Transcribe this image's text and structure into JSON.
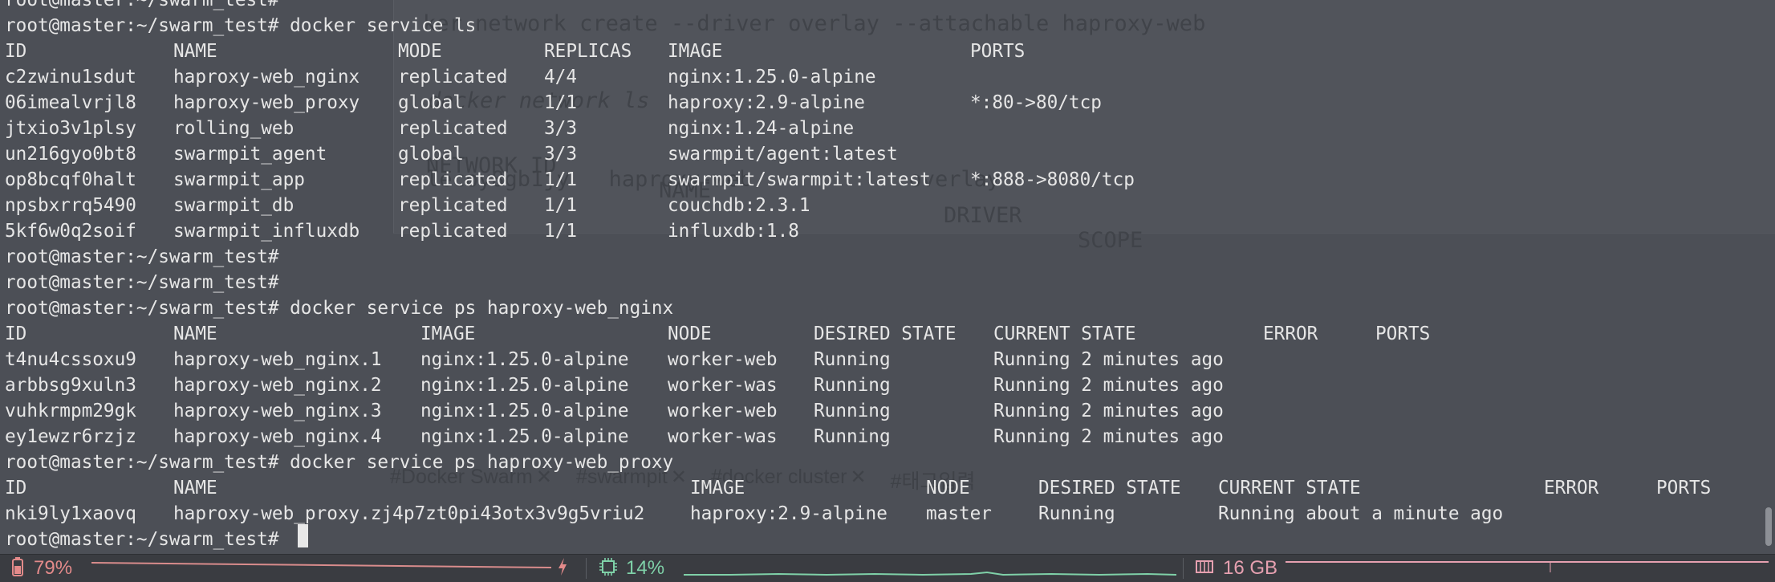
{
  "terminal": {
    "lines": [
      {
        "cols": [
          "root@master:~/swarm_test#"
        ]
      },
      {
        "cols": [
          "root@master:~/swarm_test# docker service ls"
        ]
      },
      {
        "cols": [
          "ID",
          "NAME",
          "MODE",
          "REPLICAS",
          "IMAGE",
          "PORTS"
        ]
      },
      {
        "cols": [
          "c2zwinu1sdut",
          "haproxy-web_nginx",
          "replicated",
          "4/4",
          "nginx:1.25.0-alpine",
          ""
        ]
      },
      {
        "cols": [
          "06imealvrjl8",
          "haproxy-web_proxy",
          "global",
          "1/1",
          "haproxy:2.9-alpine",
          "*:80->80/tcp"
        ]
      },
      {
        "cols": [
          "jtxio3v1plsy",
          "rolling_web",
          "replicated",
          "3/3",
          "nginx:1.24-alpine",
          ""
        ]
      },
      {
        "cols": [
          "un216gyo0bt8",
          "swarmpit_agent",
          "global",
          "3/3",
          "swarmpit/agent:latest",
          ""
        ]
      },
      {
        "cols": [
          "op8bcqf0halt",
          "swarmpit_app",
          "replicated",
          "1/1",
          "swarmpit/swarmpit:latest",
          "*:888->8080/tcp"
        ]
      },
      {
        "cols": [
          "npsbxrrq5490",
          "swarmpit_db",
          "replicated",
          "1/1",
          "couchdb:2.3.1",
          ""
        ]
      },
      {
        "cols": [
          "5kf6w0q2soif",
          "swarmpit_influxdb",
          "replicated",
          "1/1",
          "influxdb:1.8",
          ""
        ]
      },
      {
        "cols": [
          "root@master:~/swarm_test#"
        ]
      },
      {
        "cols": [
          "root@master:~/swarm_test#"
        ]
      },
      {
        "cols": [
          "root@master:~/swarm_test# docker service ps haproxy-web_nginx"
        ]
      },
      {
        "cols": [
          "ID",
          "NAME",
          "IMAGE",
          "NODE",
          "DESIRED STATE",
          "CURRENT STATE",
          "ERROR",
          "PORTS"
        ]
      },
      {
        "cols": [
          "t4nu4cssoxu9",
          "haproxy-web_nginx.1",
          "nginx:1.25.0-alpine",
          "worker-web",
          "Running",
          "Running 2 minutes ago",
          "",
          ""
        ]
      },
      {
        "cols": [
          "arbbsg9xuln3",
          "haproxy-web_nginx.2",
          "nginx:1.25.0-alpine",
          "worker-was",
          "Running",
          "Running 2 minutes ago",
          "",
          ""
        ]
      },
      {
        "cols": [
          "vuhkrmpm29gk",
          "haproxy-web_nginx.3",
          "nginx:1.25.0-alpine",
          "worker-web",
          "Running",
          "Running 2 minutes ago",
          "",
          ""
        ]
      },
      {
        "cols": [
          "ey1ewzr6rzjz",
          "haproxy-web_nginx.4",
          "nginx:1.25.0-alpine",
          "worker-was",
          "Running",
          "Running 2 minutes ago",
          "",
          ""
        ]
      },
      {
        "cols": [
          "root@master:~/swarm_test# docker service ps haproxy-web_proxy"
        ]
      },
      {
        "cols": [
          "ID",
          "NAME",
          "IMAGE",
          "NODE",
          "DESIRED STATE",
          "CURRENT STATE",
          "ERROR",
          "PORTS"
        ]
      },
      {
        "cols": [
          "nki9ly1xaovq",
          "haproxy-web_proxy.zj4p7zt0pi43otx3v9g5vriu2",
          "haproxy:2.9-alpine",
          "master",
          "Running",
          "Running about a minute ago",
          "",
          ""
        ]
      },
      {
        "cols": [
          "root@master:~/swarm_test# "
        ]
      }
    ]
  },
  "background_window": {
    "line1": "ker network create --driver overlay --attachable haproxy-web",
    "line2": "docker network ls",
    "header": [
      "NETWORK ID",
      "NAME",
      "DRIVER",
      "SCOPE"
    ],
    "row": "lecoy8gb1jy   haproxy-web            overlay",
    "tags": [
      "#Docker Swarm",
      "#swarmpit",
      "#docker cluster",
      "#태그입력"
    ]
  },
  "statusbar": {
    "battery": {
      "icon": "battery-icon",
      "label": "79%",
      "color": "#e38a8a"
    },
    "cpu": {
      "icon": "cpu-icon",
      "label": "14%",
      "color": "#7fd1a8"
    },
    "memory": {
      "icon": "memory-icon",
      "label": "16 GB",
      "color": "#e6a0b0"
    },
    "charging_icon": "lightning-icon"
  }
}
